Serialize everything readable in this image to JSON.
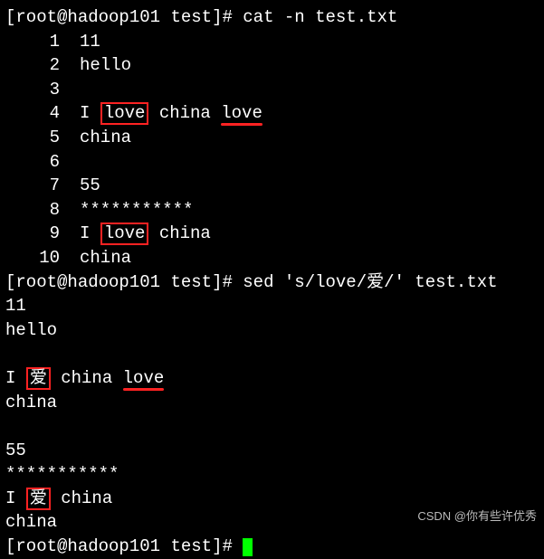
{
  "prompt": {
    "user": "root",
    "host": "hadoop101",
    "dir": "test",
    "symbol": "#"
  },
  "cmd1": "cat -n test.txt",
  "cat_output": {
    "l1": {
      "n": "1",
      "text": "11"
    },
    "l2": {
      "n": "2",
      "text": "hello"
    },
    "l3": {
      "n": "3",
      "text": ""
    },
    "l4": {
      "n": "4",
      "pre": "I ",
      "box": "love",
      "mid": " china ",
      "underline": "love"
    },
    "l5": {
      "n": "5",
      "text": "china"
    },
    "l6": {
      "n": "6",
      "text": ""
    },
    "l7": {
      "n": "7",
      "text": "55"
    },
    "l8": {
      "n": "8",
      "text": "***********"
    },
    "l9": {
      "n": "9",
      "pre": "I ",
      "box": "love",
      "post": " china"
    },
    "l10": {
      "n": "10",
      "text": "china"
    }
  },
  "cmd2": "sed 's/love/爱/' test.txt",
  "sed_output": {
    "l1": "11",
    "l2": "hello",
    "l3": "",
    "l4": {
      "pre": "I ",
      "box": "爱",
      "mid": " china ",
      "underline": "love"
    },
    "l5": "china",
    "l6": "",
    "l7": "55",
    "l8": "***********",
    "l9": {
      "pre": "I ",
      "box": "爱",
      "post": " china"
    },
    "l10": "china"
  },
  "watermark": "CSDN @你有些许优秀"
}
